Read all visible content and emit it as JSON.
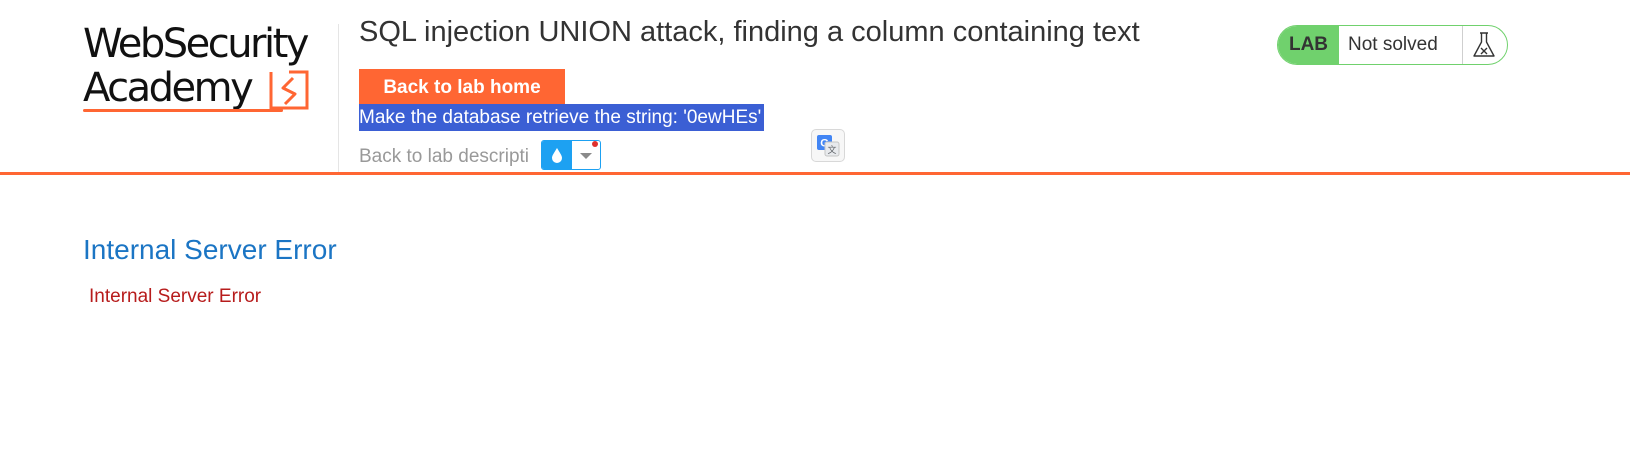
{
  "logo": {
    "line1": "WebSecurity",
    "line2": "Academy"
  },
  "lab": {
    "title": "SQL injection UNION attack, finding a column containing text",
    "back_button_label": "Back to lab home",
    "instruction": "Make the database retrieve the string: '0ewHEs'",
    "description_link": "Back to lab descripti"
  },
  "status": {
    "badge": "LAB",
    "text": "Not solved",
    "icon": "flask-icon"
  },
  "extension": {
    "icon": "drop-icon",
    "caret_icon": "caret-down-icon"
  },
  "translate": {
    "icon": "google-translate-icon"
  },
  "error": {
    "heading": "Internal Server Error",
    "message": "Internal Server Error"
  },
  "colors": {
    "accent": "#ff6633",
    "status_green": "#70d16d",
    "error_heading": "#1b75c4",
    "error_message": "#b71c1c",
    "selection": "#3b5fd4",
    "extension_blue": "#1da1f2"
  }
}
